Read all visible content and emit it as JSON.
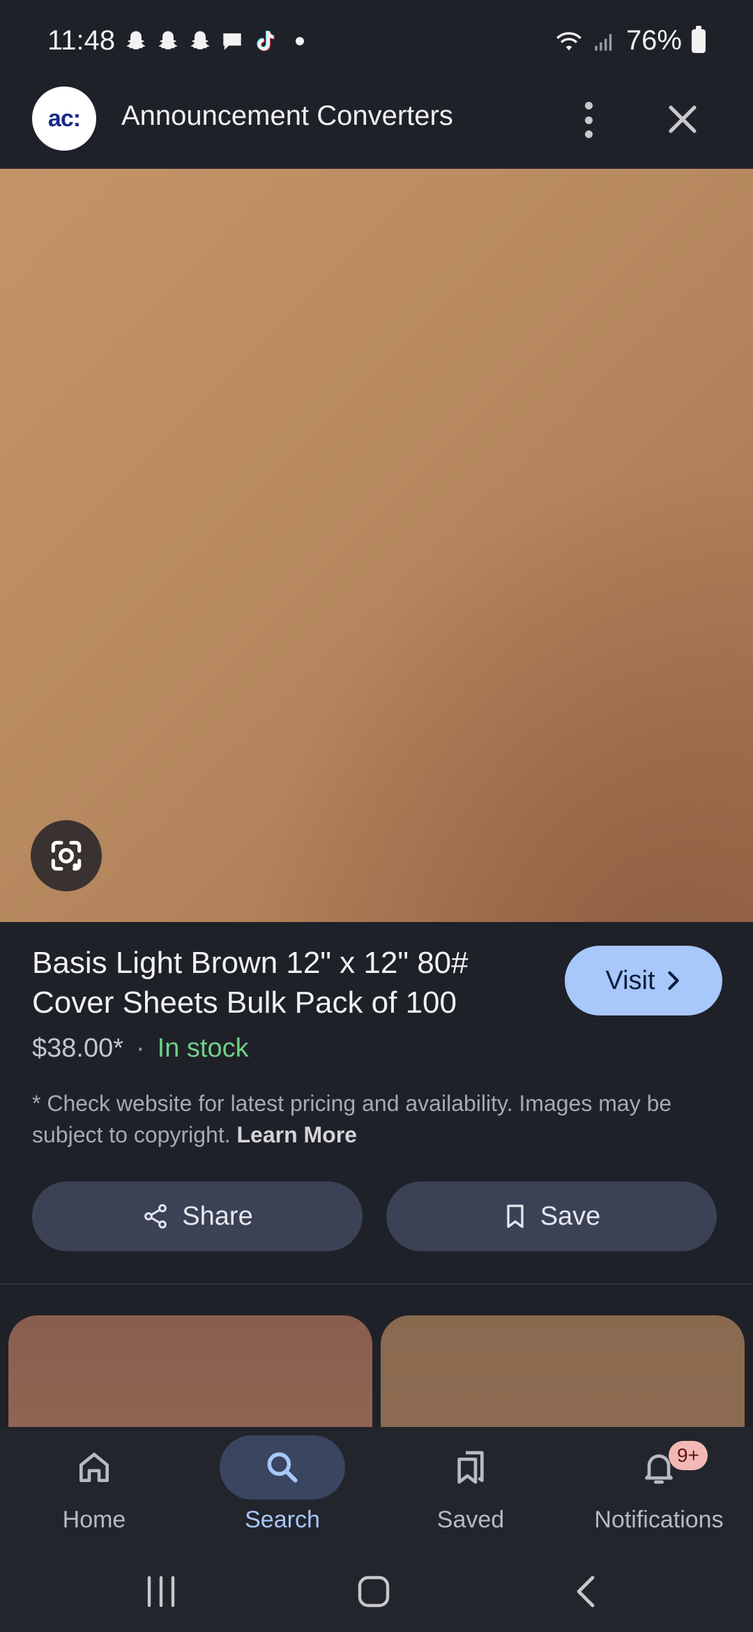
{
  "status_bar": {
    "time": "11:48",
    "battery": "76%",
    "notification_icons": [
      "snapchat-icon",
      "snapchat-icon",
      "snapchat-icon",
      "chat-bubble-icon",
      "tiktok-icon"
    ]
  },
  "header": {
    "logo_text": "ac:",
    "site_name": "Announcement Converters"
  },
  "product": {
    "title": "Basis Light Brown 12\" x 12\" 80# Cover Sheets Bulk Pack of 100",
    "visit_label": "Visit",
    "price": "$38.00*",
    "separator": "·",
    "stock": "In stock",
    "disclaimer": "* Check website for latest pricing and availability. Images may be subject to copyright.",
    "learn_more": "Learn More",
    "share_label": "Share",
    "save_label": "Save"
  },
  "bottom_nav": {
    "items": [
      {
        "label": "Home",
        "icon": "home-icon"
      },
      {
        "label": "Search",
        "icon": "search-icon",
        "active": true
      },
      {
        "label": "Saved",
        "icon": "saved-icon"
      },
      {
        "label": "Notifications",
        "icon": "bell-icon",
        "badge": "9+"
      }
    ]
  },
  "colors": {
    "background": "#1f2129",
    "accent": "#a8c7fa",
    "in_stock": "#6fcf86",
    "action_button": "#3b4256",
    "badge": "#f2b8b5"
  }
}
